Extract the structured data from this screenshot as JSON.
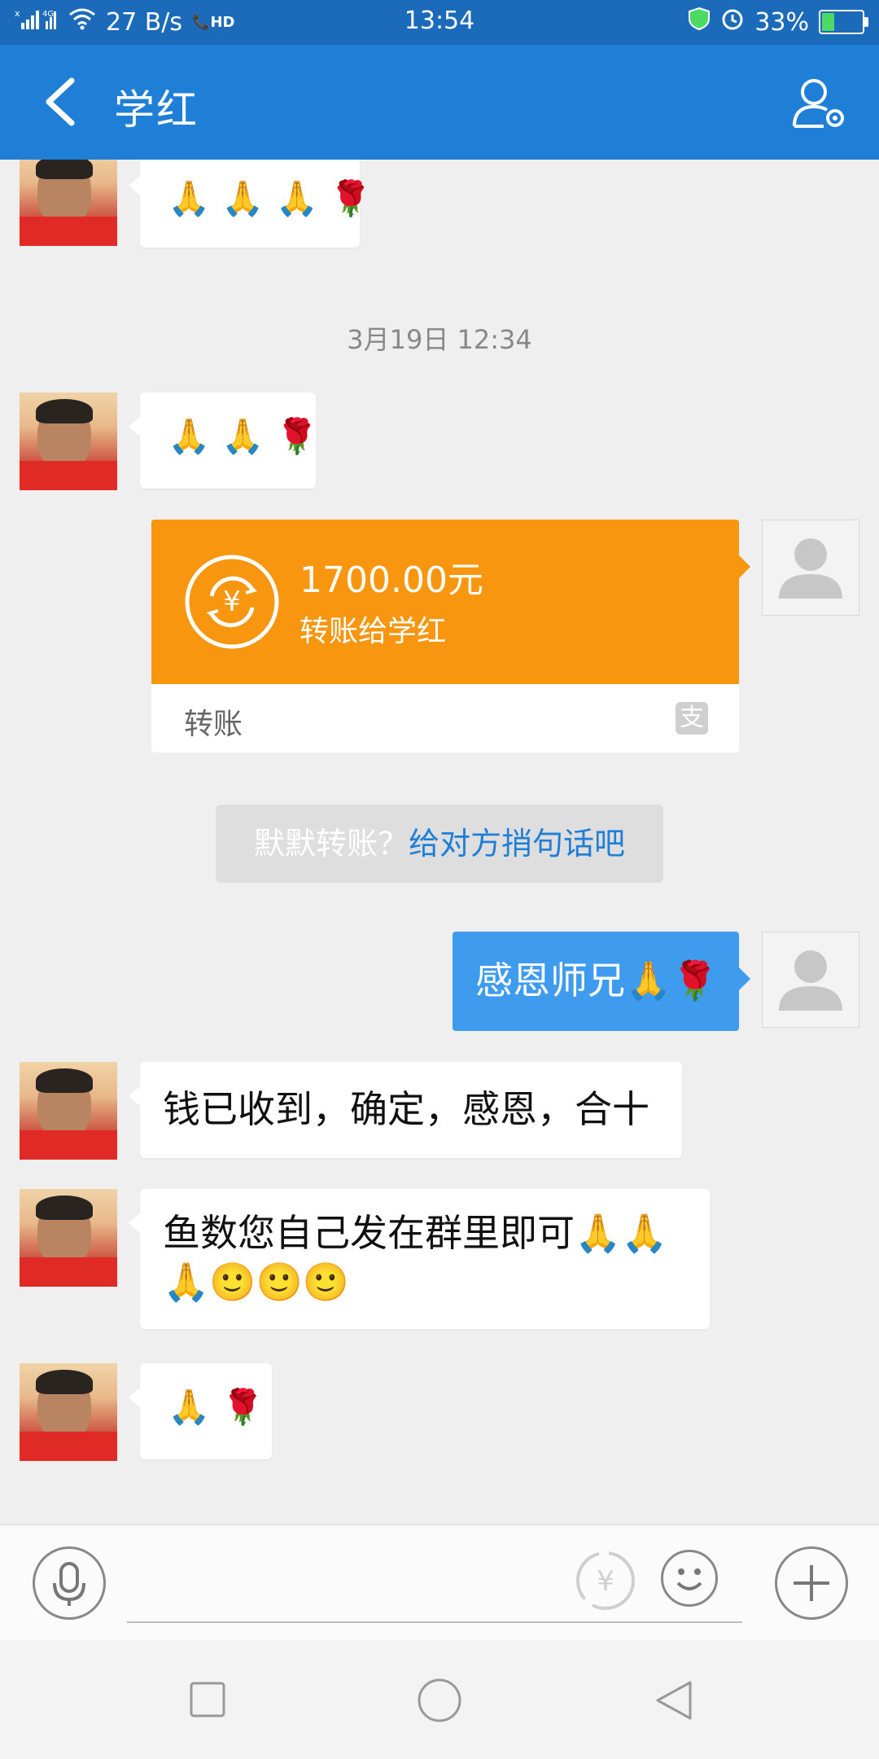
{
  "status_bar": {
    "network": "4G",
    "speed": "27 B/s",
    "hd": "HD",
    "time": "13:54",
    "battery": "33%",
    "battery_level": 0.33
  },
  "header": {
    "title": "学红"
  },
  "messages": {
    "m1_emojis": [
      "🙏",
      "🙏",
      "🙏",
      "🌹"
    ],
    "timestamp": "3月19日 12:34",
    "m2_emojis": [
      "🙏",
      "🙏",
      "🌹"
    ],
    "transfer": {
      "amount": "1700.00元",
      "description": "转账给学红",
      "label": "转账",
      "brand_glyph": "支"
    },
    "notice": {
      "prefix": "默默转账？",
      "link": "给对方捎句话吧"
    },
    "m3_out": "感恩师兄🙏🌹",
    "m4_in": "钱已收到，确定，感恩，合十",
    "m5_in": "鱼数您自己发在群里即可🙏🙏🙏🙂🙂🙂",
    "m6_emojis": [
      "🙏",
      "🌹"
    ]
  },
  "colors": {
    "header_bg": "#1f7ed6",
    "out_bubble": "#3f9bed",
    "transfer_orange": "#f8960f"
  }
}
